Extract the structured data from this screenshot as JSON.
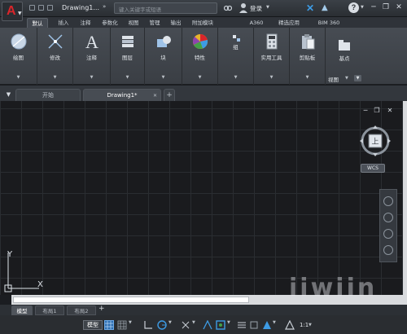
{
  "titlebar": {
    "document_title": "Drawing1...",
    "search_placeholder": "键入关键字或短语",
    "login_label": "登录"
  },
  "ribbon_tabs": [
    "默认",
    "插入",
    "注释",
    "参数化",
    "视图",
    "管理",
    "输出",
    "附加模块",
    "A360",
    "精选应用",
    "BIM 360"
  ],
  "ribbon_groups": [
    {
      "label": "绘图",
      "icon": "draw-circle-icon"
    },
    {
      "label": "修改",
      "icon": "modify-move-icon"
    },
    {
      "label": "注释",
      "icon": "text-a-icon"
    },
    {
      "label": "图层",
      "icon": "layers-icon"
    },
    {
      "label": "块",
      "icon": "block-icon"
    },
    {
      "label": "特性",
      "icon": "color-wheel-icon"
    },
    {
      "label": "组",
      "icon": "group-icon"
    },
    {
      "label": "实用工具",
      "icon": "calculator-icon"
    },
    {
      "label": "剪贴板",
      "icon": "clipboard-icon"
    },
    {
      "label": "基点",
      "icon": "base-point-icon"
    }
  ],
  "ribbon_view_label": "视图",
  "file_tabs": [
    {
      "label": "开始",
      "active": false
    },
    {
      "label": "Drawing1*",
      "active": true
    }
  ],
  "viewcube": {
    "face": "上",
    "wcs_label": "WCS"
  },
  "ucs": {
    "x_label": "X",
    "y_label": "Y"
  },
  "layout_tabs": [
    {
      "label": "模型",
      "active": true
    },
    {
      "label": "布局1",
      "active": false
    },
    {
      "label": "布局2",
      "active": false
    }
  ],
  "status": {
    "model_label": "模型",
    "scale_label": "1:1"
  },
  "watermark": "iiwiin",
  "colors": {
    "brand_red": "#d9252a",
    "accent_blue": "#3d9be4",
    "canvas_bg": "#1a1b1e"
  }
}
